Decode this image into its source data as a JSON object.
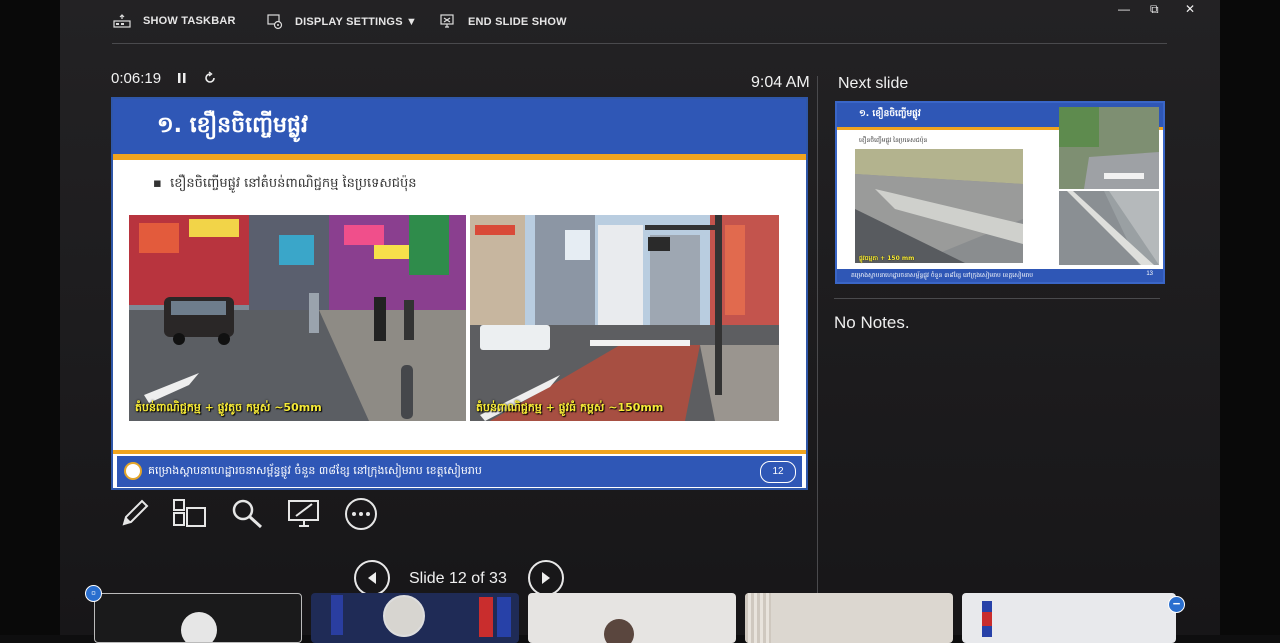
{
  "toolbar": {
    "show_taskbar": "SHOW TASKBAR",
    "display_settings": "DISPLAY SETTINGS ▼",
    "end_slide_show": "END SLIDE SHOW"
  },
  "window": {
    "minimize": "—",
    "restore": "⧉",
    "close": "✕"
  },
  "presenter": {
    "timer": "0:06:19",
    "clock": "9:04 AM",
    "next_slide_label": "Next slide",
    "notes": "No Notes.",
    "slide_counter": "Slide 12 of 33"
  },
  "current_slide": {
    "title": "១. ខឿនចិញ្ចើមផ្លូវ",
    "bullet": "ខឿនចិញ្ចើមផ្លូវ នៅតំបន់ពាណិជ្ជកម្ម នៃប្រទេសជប៉ុន",
    "photo_left_caption": "តំបន់ពាណិជ្ជកម្ម + ផ្លូវតូច កម្ពស់ ~50mm",
    "photo_right_caption": "តំបន់ពាណិជ្ជកម្ម + ផ្លូវធំ កម្ពស់ ~150mm",
    "footer": "គម្រោងស្តាបនាហេដ្ឋារចនាសម្ព័ន្ធផ្លូវ ចំនួន ៣៨ខ្សែ នៅក្រុងសៀមរាប ខេត្តសៀមរាប",
    "page_number": "12"
  },
  "next_slide": {
    "title": "១. ខឿនចិញ្ចើមផ្លូវ",
    "bullet": "ខឿនចិញ្ចើមផ្លូវ នៃប្រទេសជប៉ុន",
    "caption": "ផ្លូវធម្មតា + 150 mm",
    "footer": "គម្រោងស្តាបនាហេដ្ឋារចនាសម្ព័ន្ធផ្លូវ ចំនួន ៣៨ខ្សែ នៅក្រុងសៀមរាប ខេត្តសៀមរាប",
    "page_number": "13"
  },
  "colors": {
    "slide_blue": "#2f57b6",
    "slide_orange": "#f0a41f",
    "caption_yellow": "#f6ea37",
    "badge_blue": "#2a6fcf"
  },
  "tools": [
    "pen-icon",
    "grid-icon",
    "zoom-icon",
    "screen-icon",
    "more-icon"
  ]
}
